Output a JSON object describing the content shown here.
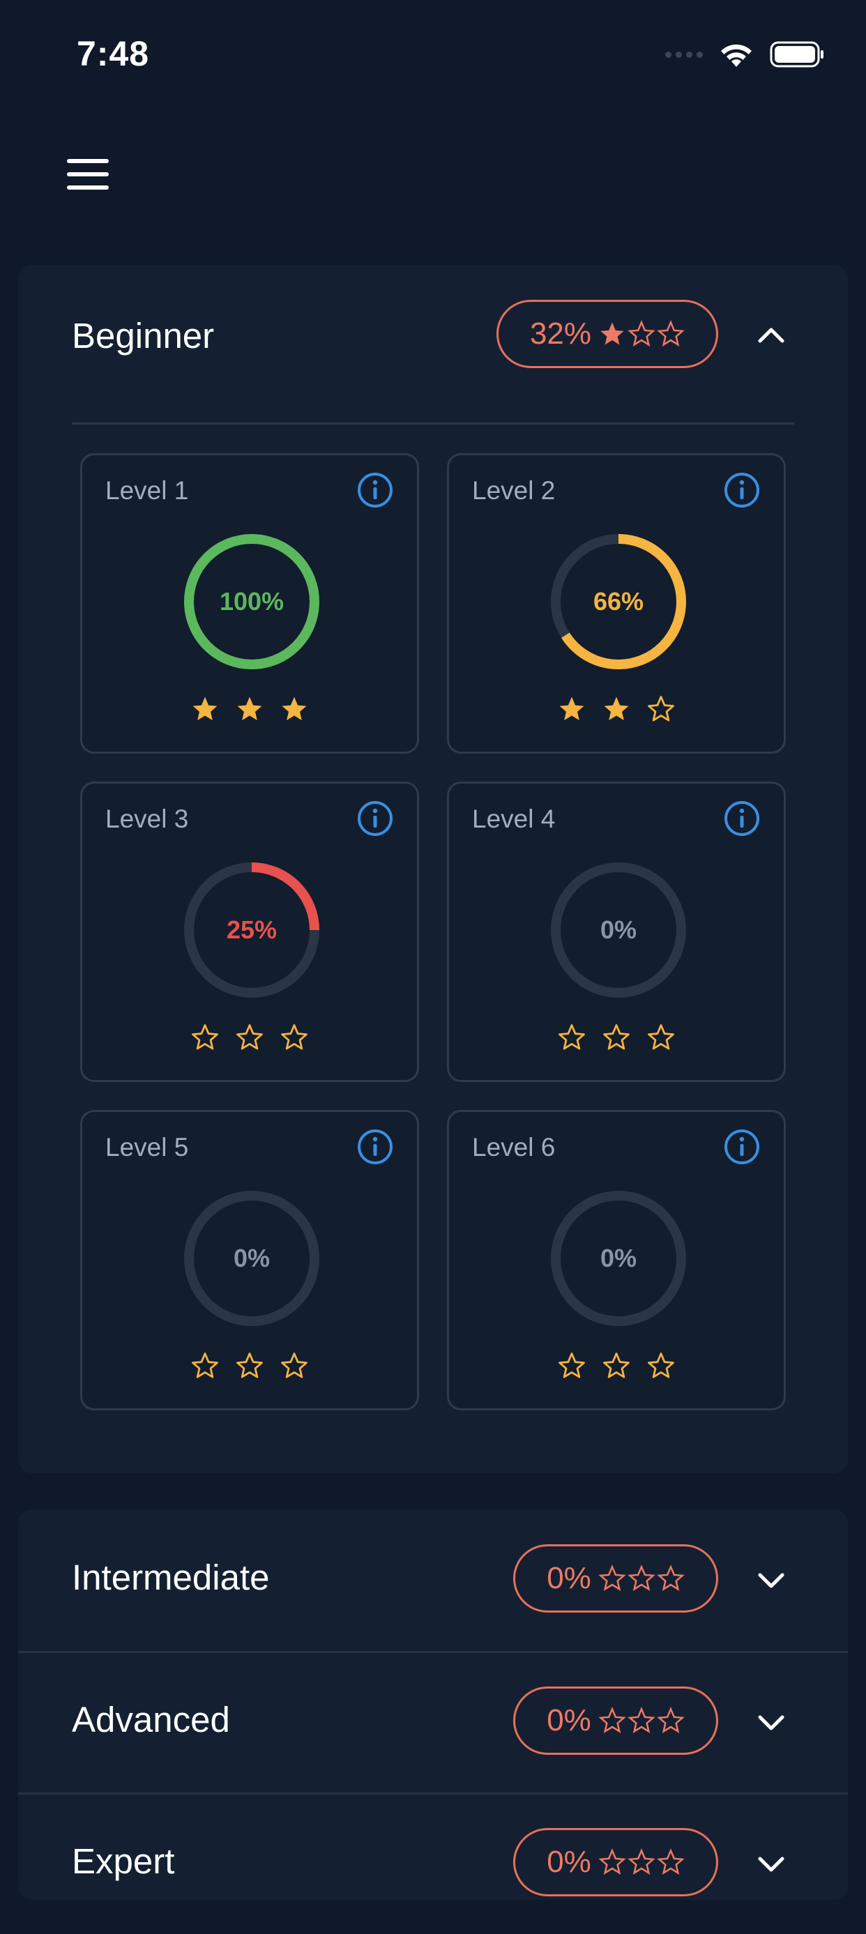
{
  "status_bar": {
    "time": "7:48"
  },
  "colors": {
    "background": "#0f1929",
    "card": "#142032",
    "accent_pill": "#e8705a",
    "star": "#f6b440",
    "info": "#3a8fe0",
    "complete": "#5cb85c",
    "partial": "#f6b440",
    "low": "#e8514d",
    "empty": "#2b3545"
  },
  "menu": {
    "icon": "hamburger-menu-icon"
  },
  "beginner": {
    "title": "Beginner",
    "score": "32%",
    "stars_filled": 1,
    "stars_total": 3,
    "expanded": true,
    "levels": [
      {
        "label": "Level 1",
        "progress_text": "100%",
        "progress": 1.0,
        "stars_filled": 3,
        "color": "#5cb85c"
      },
      {
        "label": "Level 2",
        "progress_text": "66%",
        "progress": 0.66,
        "stars_filled": 2,
        "color": "#f6b440"
      },
      {
        "label": "Level 3",
        "progress_text": "25%",
        "progress": 0.25,
        "stars_filled": 0,
        "color": "#e8514d"
      },
      {
        "label": "Level 4",
        "progress_text": "0%",
        "progress": 0,
        "stars_filled": 0,
        "color": "#8b94a3"
      },
      {
        "label": "Level 5",
        "progress_text": "0%",
        "progress": 0,
        "stars_filled": 0,
        "color": "#8b94a3"
      },
      {
        "label": "Level 6",
        "progress_text": "0%",
        "progress": 0,
        "stars_filled": 0,
        "color": "#8b94a3"
      }
    ]
  },
  "sections": [
    {
      "title": "Intermediate",
      "score": "0%",
      "stars_filled": 0,
      "stars_total": 3,
      "expanded": false
    },
    {
      "title": "Advanced",
      "score": "0%",
      "stars_filled": 0,
      "stars_total": 3,
      "expanded": false
    },
    {
      "title": "Expert",
      "score": "0%",
      "stars_filled": 0,
      "stars_total": 3,
      "expanded": false
    }
  ]
}
